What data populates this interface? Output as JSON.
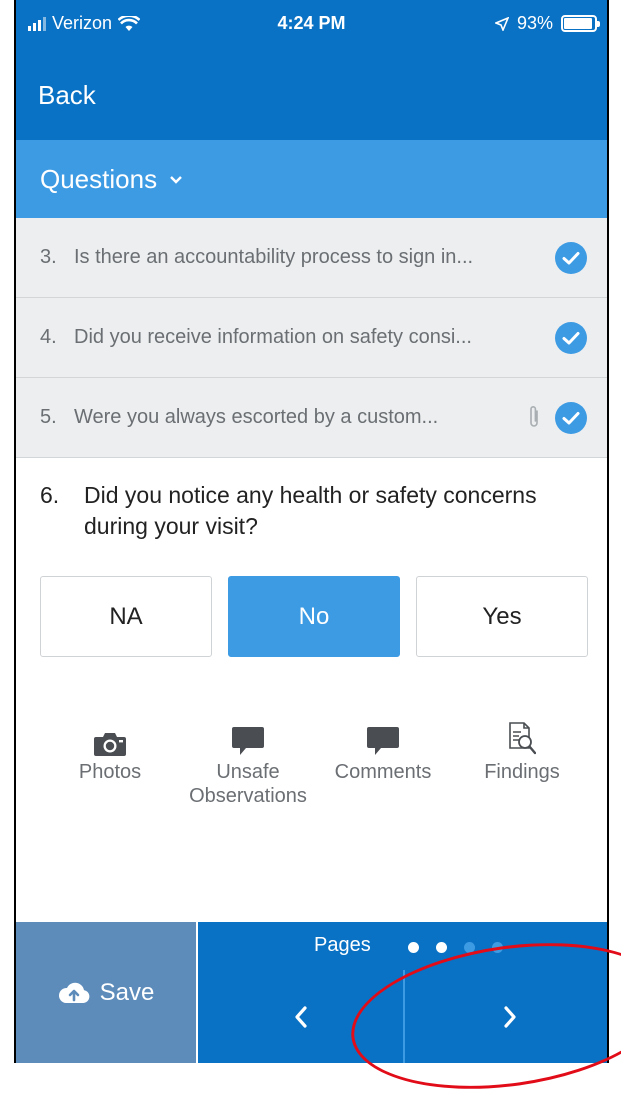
{
  "status": {
    "carrier": "Verizon",
    "time": "4:24 PM",
    "battery": "93%",
    "battery_level": 0.93
  },
  "header": {
    "back_label": "Back"
  },
  "section": {
    "title": "Questions"
  },
  "questions": [
    {
      "num": "3.",
      "text": "Is there an accountability process to sign in...",
      "answered": true
    },
    {
      "num": "4.",
      "text": "Did you receive information on safety consi...",
      "answered": true
    },
    {
      "num": "5.",
      "text": "Were you always escorted by a custom...",
      "answered": true,
      "attachment": true
    }
  ],
  "current": {
    "num": "6.",
    "text": "Did you notice any health or safety concerns during your visit?"
  },
  "options": [
    {
      "label": "NA",
      "selected": false
    },
    {
      "label": "No",
      "selected": true
    },
    {
      "label": "Yes",
      "selected": false
    }
  ],
  "actions": {
    "photos": "Photos",
    "unsafe": "Unsafe Observations",
    "comments": "Comments",
    "findings": "Findings"
  },
  "footer": {
    "save_label": "Save",
    "pages_label": "Pages",
    "prev_icon": "‹",
    "next_icon": "›",
    "page_count": 4,
    "current_page": 2
  },
  "colors": {
    "header": "#0a72c4",
    "accent": "#3d9be4",
    "save": "#5d8cbb",
    "annotation": "#e10c18"
  }
}
